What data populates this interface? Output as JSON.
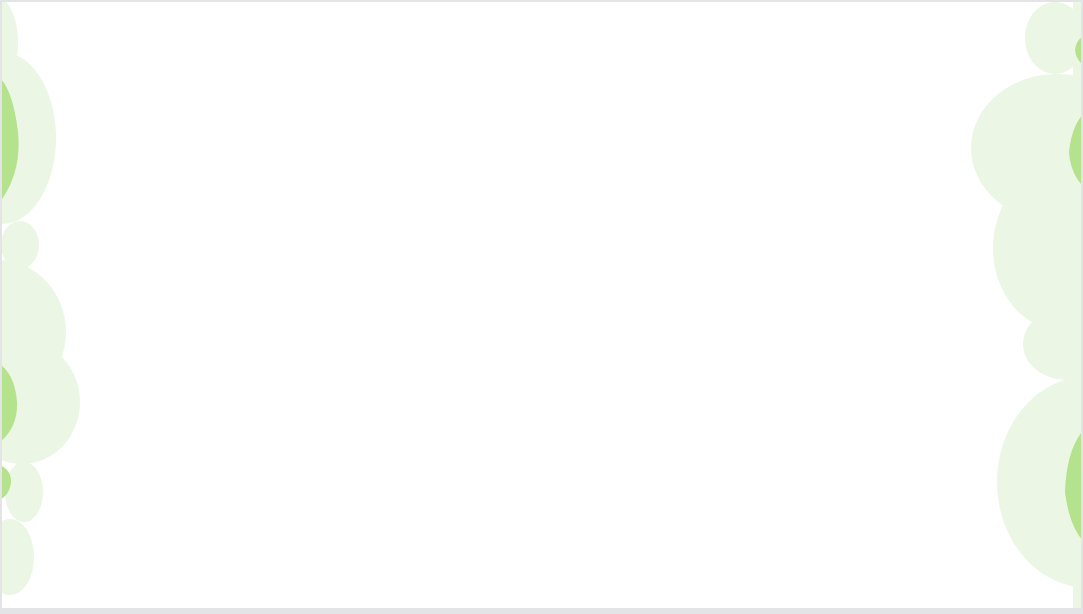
{
  "slide": {
    "background": "#ffffff",
    "frame_color": "#e3e4e6"
  },
  "decorations": {
    "light_green": "#ebf6e5",
    "mid_green": "#b5e28c",
    "style": "cloud-shapes"
  }
}
